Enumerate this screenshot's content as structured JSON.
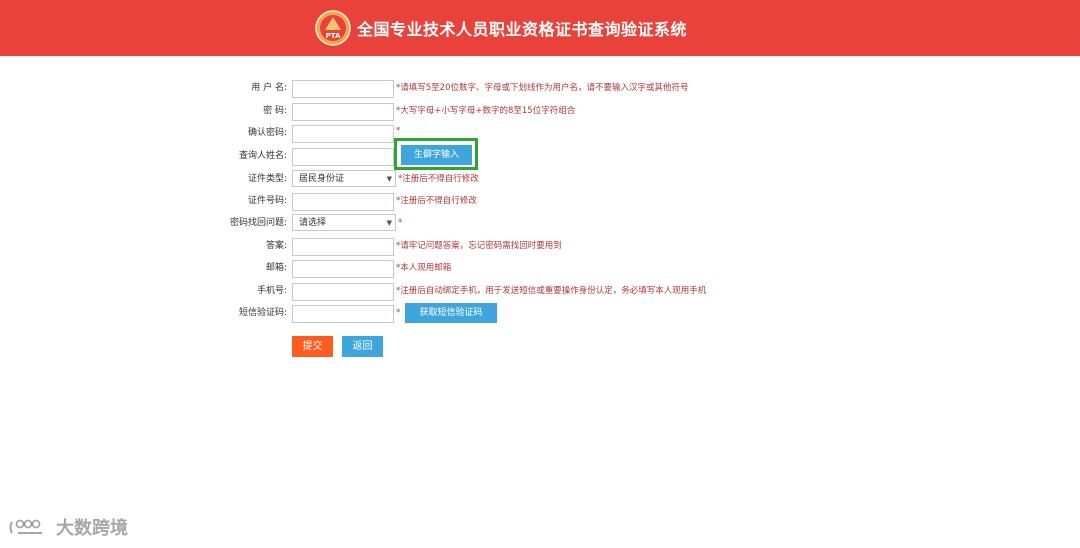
{
  "header": {
    "logo_text": "PTA",
    "title": "全国专业技术人员职业资格证书查询验证系统"
  },
  "form": {
    "username": {
      "label": "用 户 名:",
      "hint": "*请填写5至20位数字、字母或下划线作为用户名，请不要输入汉字或其他符号",
      "value": ""
    },
    "password": {
      "label": "密    码:",
      "hint": "*大写字母+小写字母+数字的8至15位字符组合",
      "value": ""
    },
    "confirm_password": {
      "label": "确认密码:",
      "hint": "*",
      "value": ""
    },
    "name": {
      "label": "查询人姓名:",
      "value": "",
      "rare_char_button": "生僻字输入"
    },
    "id_type": {
      "label": "证件类型:",
      "selected": "居民身份证",
      "hint": "*注册后不得自行修改"
    },
    "id_number": {
      "label": "证件号码:",
      "hint": "*注册后不得自行修改",
      "value": ""
    },
    "security_question": {
      "label": "密码找回问题:",
      "selected": "请选择",
      "hint": "*"
    },
    "answer": {
      "label": "答案:",
      "hint": "*请牢记问题答案，忘记密码需找回时要用到",
      "value": ""
    },
    "email": {
      "label": "邮箱:",
      "hint": "*本人现用邮箱",
      "value": ""
    },
    "phone": {
      "label": "手机号:",
      "hint": "*注册后自动绑定手机，用于发送短信或重要操作身份认定，务必填写本人现用手机",
      "value": ""
    },
    "sms_code": {
      "label": "短信验证码:",
      "hint": "*",
      "value": "",
      "get_code_button": "获取短信验证码"
    }
  },
  "actions": {
    "submit": "提交",
    "back": "返回"
  },
  "watermark": {
    "text": "大数跨境"
  },
  "colors": {
    "header_bg": "#e8423a",
    "hint_red": "#b0373a",
    "button_blue": "#3fa6dd",
    "submit_orange": "#ff5a1f",
    "highlight_green": "#2fa333"
  }
}
